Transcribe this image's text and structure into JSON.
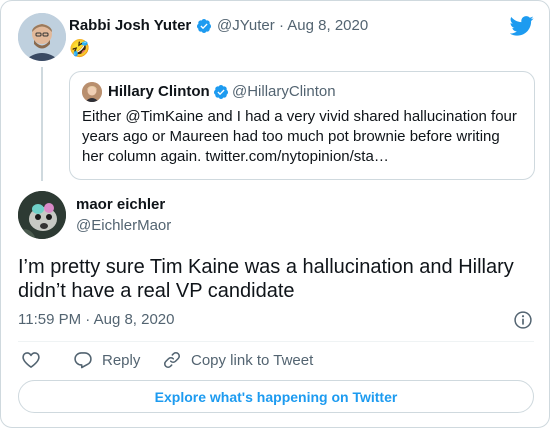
{
  "colors": {
    "accent": "#1d9bf0",
    "text": "#0f1419",
    "muted": "#536471",
    "border": "#cfd9de"
  },
  "parent_tweet": {
    "author_name": "Rabbi Josh Yuter",
    "handle": "@JYuter",
    "separator": "·",
    "date": "Aug 8, 2020",
    "verified": true,
    "text": "🤣"
  },
  "quoted_tweet": {
    "author_name": "Hillary Clinton",
    "handle": "@HillaryClinton",
    "verified": true,
    "text": "Either @TimKaine and I had a very vivid shared hallucination four years ago or Maureen had too much pot brownie before writing her column again. twitter.com/nytopinion/sta…"
  },
  "main_tweet": {
    "author_name": "maor eichler",
    "handle": "@EichlerMaor",
    "text": "I’m pretty sure Tim Kaine was a hallucination and Hillary didn’t have a real VP candidate",
    "timestamp": "11:59 PM · Aug 8, 2020"
  },
  "actions": {
    "reply_label": "Reply",
    "copy_label": "Copy link to Tweet"
  },
  "explore_button": {
    "label": "Explore what's happening on Twitter"
  },
  "icons": [
    "twitter-bird-icon",
    "verified-badge-icon",
    "heart-icon",
    "reply-icon",
    "link-icon",
    "info-icon"
  ]
}
